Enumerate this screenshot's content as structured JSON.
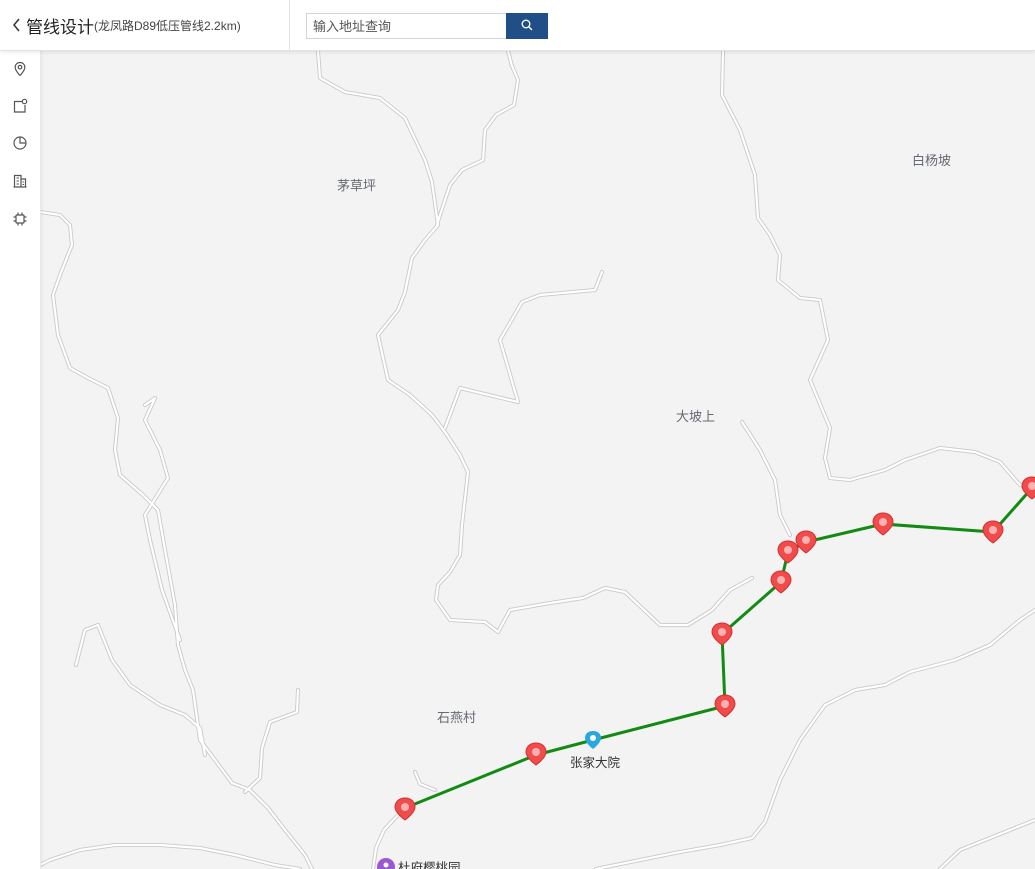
{
  "header": {
    "title": "管线设计",
    "subtitle": "(龙凤路D89低压管线2.2km)",
    "back_icon": "chevron-left-icon"
  },
  "search": {
    "placeholder": "输入地址查询",
    "value": "",
    "button_icon": "search-icon",
    "button_color": "#1f4f86"
  },
  "sidebar": {
    "tools": [
      {
        "name": "location-pin-icon"
      },
      {
        "name": "area-marker-icon"
      },
      {
        "name": "pie-chart-icon"
      },
      {
        "name": "building-icon"
      },
      {
        "name": "chip-icon"
      }
    ]
  },
  "map": {
    "place_names": [
      "茅草坪",
      "白杨坡",
      "大坡上",
      "石燕村"
    ],
    "pois": [
      {
        "name": "张家大院",
        "color": "#29a8e0"
      },
      {
        "name": "杜府樱桃园",
        "color": "#9b59d0"
      }
    ],
    "pipeline": {
      "line_color": "#138a13",
      "marker_color": "#f24b4b",
      "marker_count": 12
    }
  }
}
